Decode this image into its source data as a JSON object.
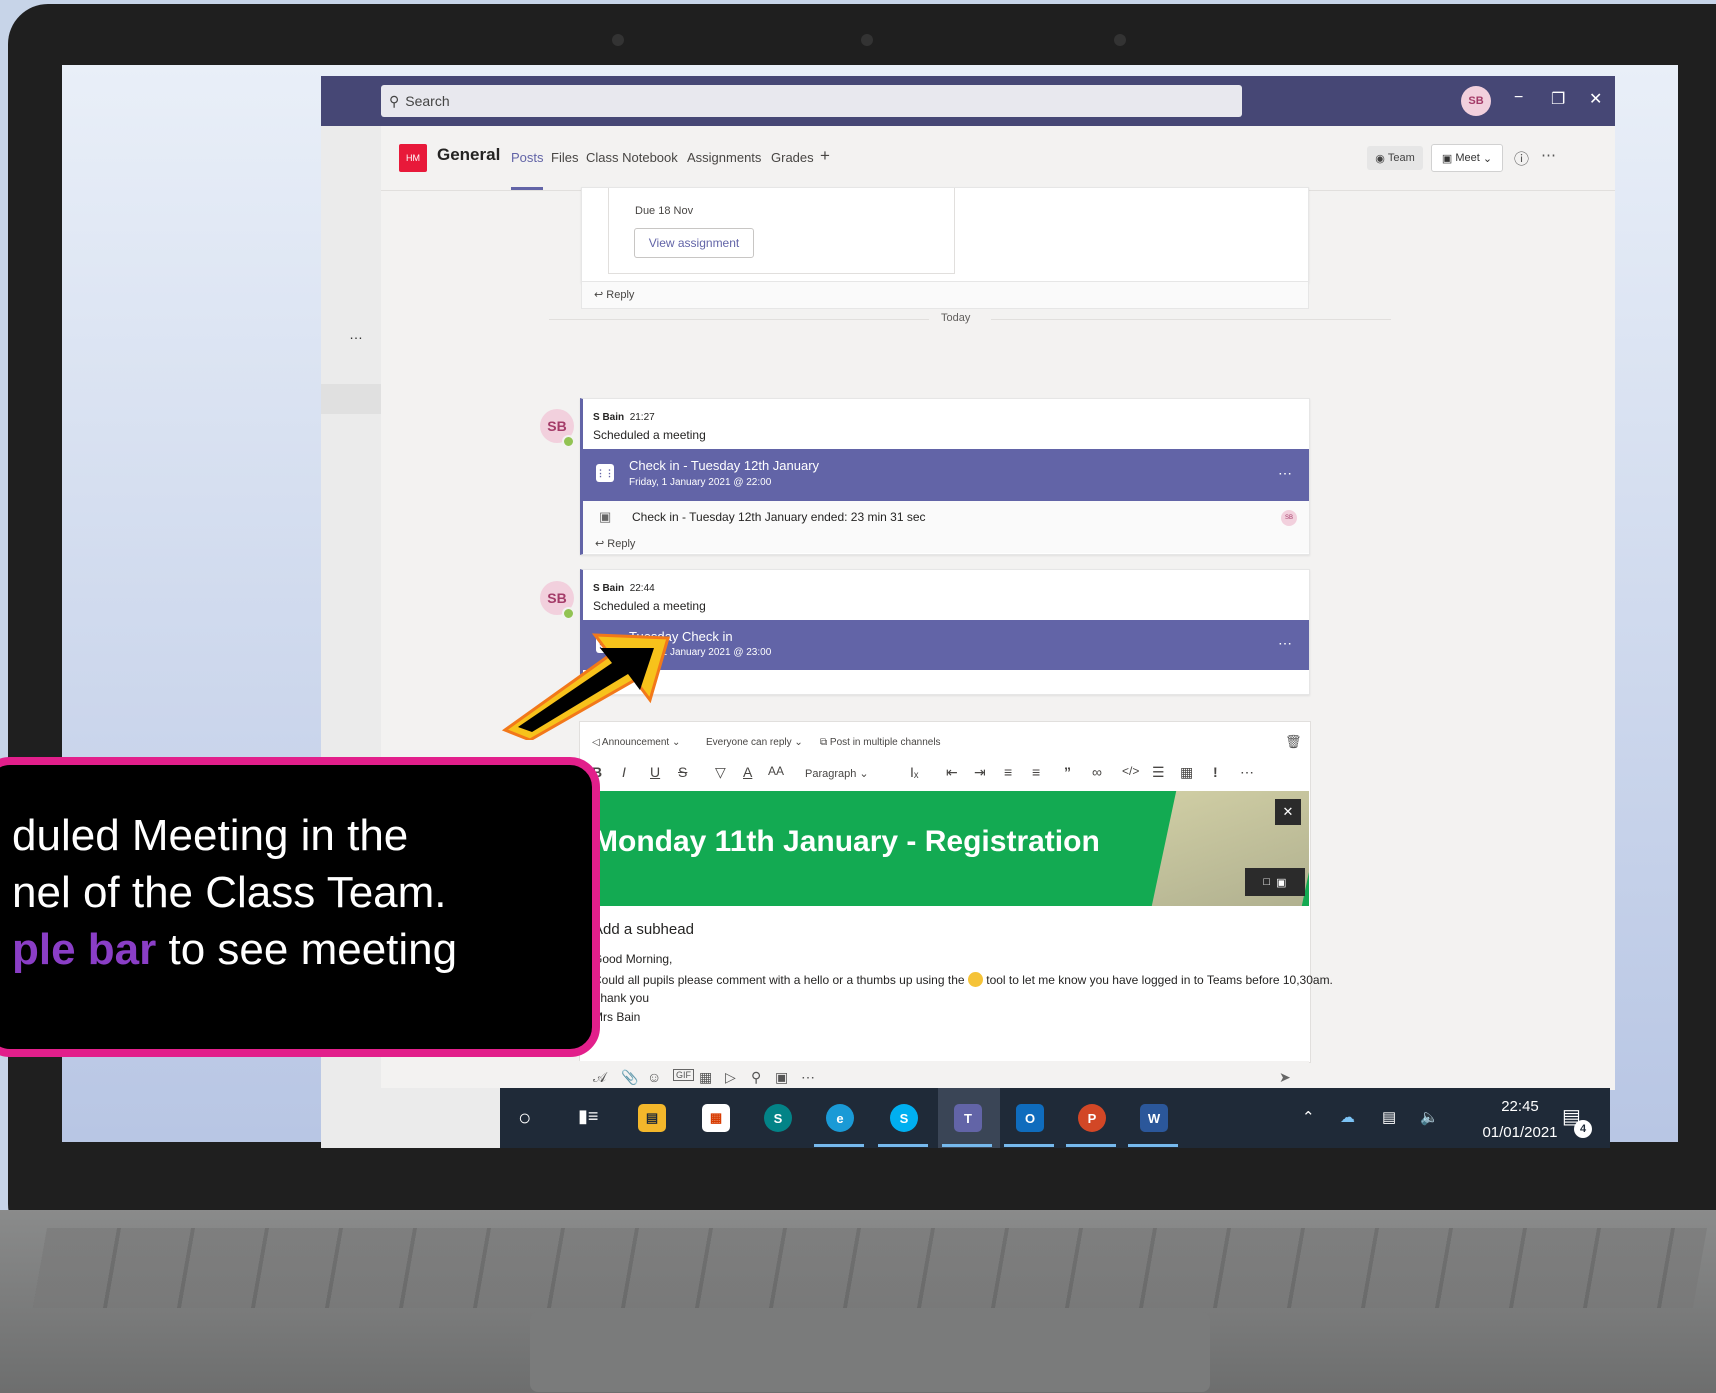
{
  "titlebar": {
    "search_placeholder": "Search",
    "avatar_initials": "SB",
    "minimize": "−",
    "maximize": "❐",
    "close": "✕"
  },
  "leftrail": {
    "more": "…"
  },
  "channel": {
    "tile_initials": "HM",
    "name": "General",
    "tabs": [
      "Posts",
      "Files",
      "Class Notebook",
      "Assignments",
      "Grades"
    ],
    "add_tab": "+",
    "team_label": "Team",
    "meet_label": "Meet",
    "info": "ⓘ",
    "more": "⋯"
  },
  "assignment_card": {
    "due": "Due 18 Nov",
    "button": "View assignment",
    "reply": "Reply"
  },
  "divider_label": "Today",
  "posts": [
    {
      "avatar": "SB",
      "author": "S Bain",
      "time": "21:27",
      "action": "Scheduled a meeting",
      "meeting_title": "Check in - Tuesday 12th January",
      "meeting_when": "Friday, 1 January 2021 @ 22:00",
      "ended_text": "Check in - Tuesday 12th January ended: 23 min 31 sec",
      "participant": "SB",
      "reply": "Reply"
    },
    {
      "avatar": "SB",
      "author": "S Bain",
      "time": "22:44",
      "action": "Scheduled a meeting",
      "meeting_title": "Tuesday Check in",
      "meeting_when": "Friday, 1 January 2021 @ 23:00"
    }
  ],
  "composer": {
    "announcement": "Announcement",
    "reply_setting": "Everyone can reply",
    "multi_channel": "Post in multiple channels",
    "paragraph": "Paragraph",
    "banner_title": "Monday 11th January - Registration",
    "subhead": "Add a subhead",
    "body": [
      "Good Morning,",
      "Could all pupils please comment with a hello or a thumbs up using the",
      "tool to let me know you have logged in to Teams before 10,30am.",
      "Thank you",
      "Mrs Bain"
    ]
  },
  "taskbar": {
    "time": "22:45",
    "date": "01/01/2021",
    "notifications": "4",
    "apps": [
      "File Explorer",
      "Store",
      "SharePoint",
      "Edge",
      "Skype",
      "Teams",
      "Outlook",
      "PowerPoint",
      "Word"
    ]
  },
  "callout": {
    "line1": "duled Meeting in the",
    "line2": "nel of the Class Team.",
    "line3_highlight": "ple bar",
    "line3_rest": " to see meeting"
  },
  "colors": {
    "teams_purple": "#6264a7",
    "titlebar": "#464775",
    "banner_green": "#13aa52",
    "callout_border": "#e21f8b",
    "callout_highlight": "#8a3ec6"
  }
}
